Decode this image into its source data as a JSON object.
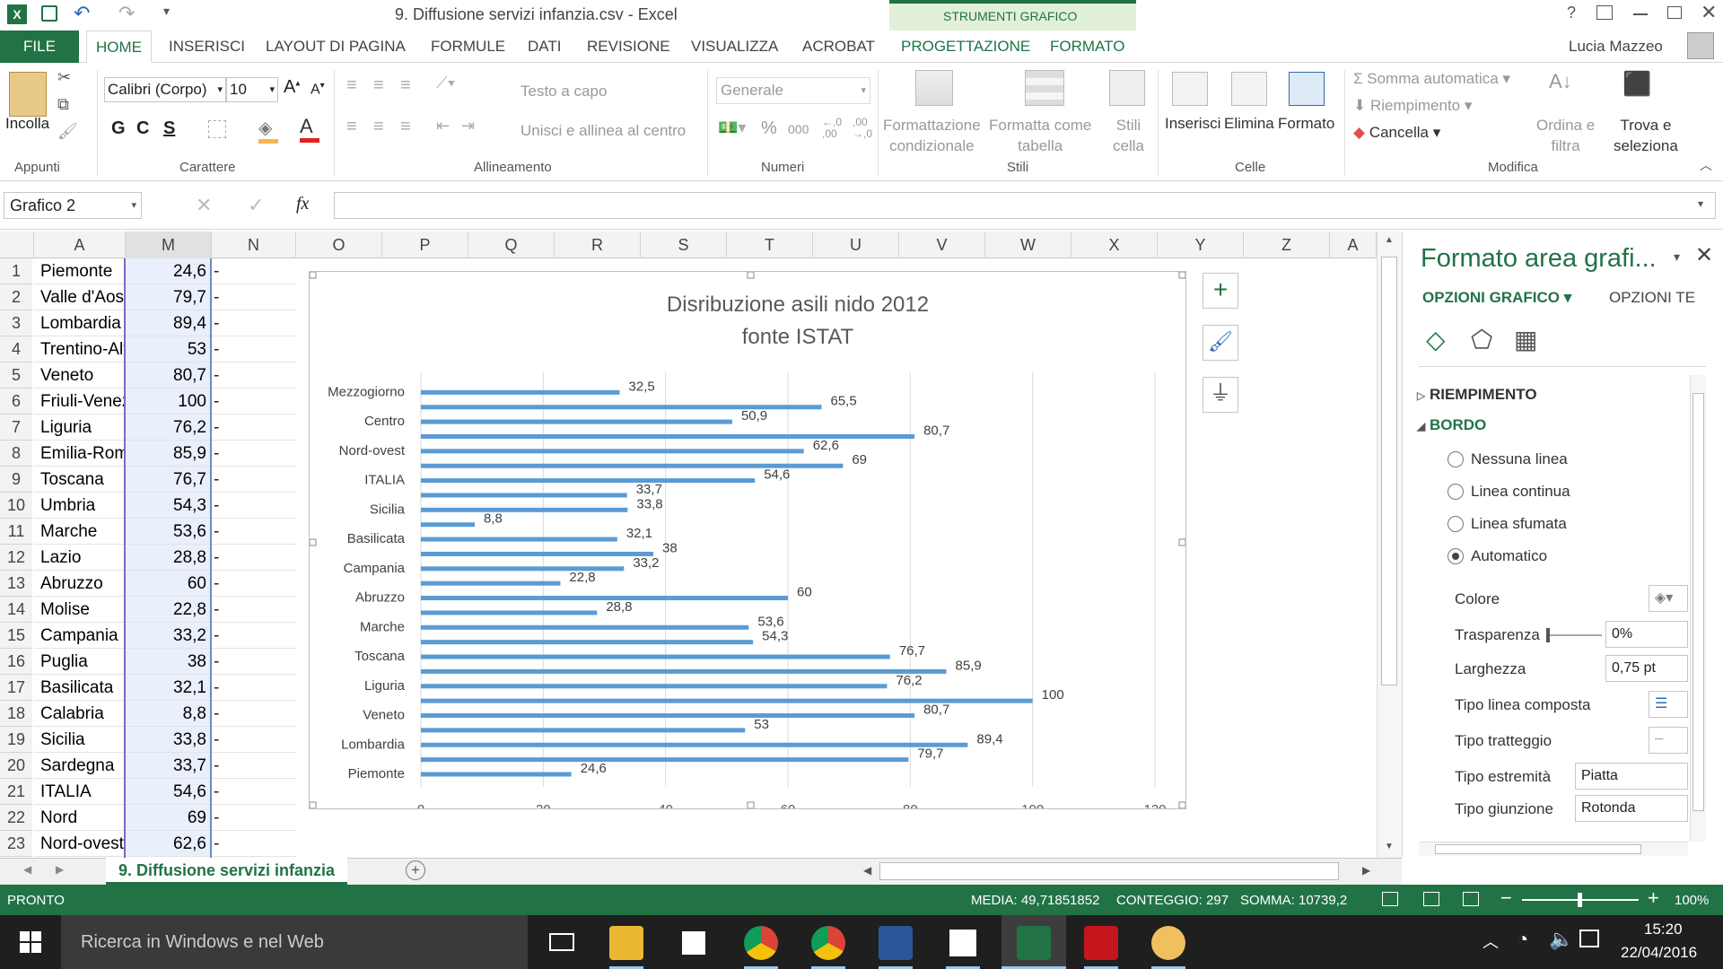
{
  "window": {
    "title": "9. Diffusione servizi infanzia.csv - Excel",
    "tools_group": "STRUMENTI GRAFICO",
    "user": "Lucia Mazzeo"
  },
  "tabs": [
    "FILE",
    "HOME",
    "INSERISCI",
    "LAYOUT DI PAGINA",
    "FORMULE",
    "DATI",
    "REVISIONE",
    "VISUALIZZA",
    "ACROBAT",
    "PROGETTAZIONE",
    "FORMATO"
  ],
  "ribbon": {
    "incolla": "Incolla",
    "font_name": "Calibri (Corpo)",
    "font_size": "10",
    "bold": "G",
    "italic": "C",
    "underline": "S",
    "testo_a_capo": "Testo a capo",
    "unisci": "Unisci e allinea al centro",
    "number_format": "Generale",
    "percent": "%",
    "thousands": "000",
    "dec_inc": "←,0\n,00",
    "dec_dec": ",00\n→,0",
    "formattazione": "Formattazione\ncondizionale",
    "formatta_tabella": "Formatta come\ntabella",
    "stili_cella": "Stili\ncella",
    "inserisci": "Inserisci",
    "elimina": "Elimina",
    "formato": "Formato",
    "somma": "Somma automatica",
    "riempimento": "Riempimento",
    "cancella": "Cancella",
    "ordina": "Ordina e\nfiltra",
    "trova": "Trova e\nseleziona",
    "groups": [
      "Appunti",
      "Carattere",
      "Allineamento",
      "Numeri",
      "Stili",
      "Celle",
      "Modifica"
    ]
  },
  "formula_bar": {
    "name_box": "Grafico 2",
    "fx": "fx",
    "value": ""
  },
  "columns": [
    "A",
    "M",
    "N",
    "O",
    "P",
    "Q",
    "R",
    "S",
    "T",
    "U",
    "V",
    "W",
    "X",
    "Y",
    "Z",
    "A"
  ],
  "rows": [
    {
      "n": "1",
      "a": "Piemonte",
      "m": "24,6",
      "n_col": "-"
    },
    {
      "n": "2",
      "a": "Valle d'Aosta",
      "m": "79,7",
      "n_col": "-"
    },
    {
      "n": "3",
      "a": "Lombardia",
      "m": "89,4",
      "n_col": "-"
    },
    {
      "n": "4",
      "a": "Trentino-Alto Adige",
      "m": "53",
      "n_col": "-"
    },
    {
      "n": "5",
      "a": "Veneto",
      "m": "80,7",
      "n_col": "-"
    },
    {
      "n": "6",
      "a": "Friuli-Venezia Giulia",
      "m": "100",
      "n_col": "-"
    },
    {
      "n": "7",
      "a": "Liguria",
      "m": "76,2",
      "n_col": "-"
    },
    {
      "n": "8",
      "a": "Emilia-Romagna",
      "m": "85,9",
      "n_col": "-"
    },
    {
      "n": "9",
      "a": "Toscana",
      "m": "76,7",
      "n_col": "-"
    },
    {
      "n": "10",
      "a": "Umbria",
      "m": "54,3",
      "n_col": "-"
    },
    {
      "n": "11",
      "a": "Marche",
      "m": "53,6",
      "n_col": "-"
    },
    {
      "n": "12",
      "a": "Lazio",
      "m": "28,8",
      "n_col": "-"
    },
    {
      "n": "13",
      "a": "Abruzzo",
      "m": "60",
      "n_col": "-"
    },
    {
      "n": "14",
      "a": "Molise",
      "m": "22,8",
      "n_col": "-"
    },
    {
      "n": "15",
      "a": "Campania",
      "m": "33,2",
      "n_col": "-"
    },
    {
      "n": "16",
      "a": "Puglia",
      "m": "38",
      "n_col": "-"
    },
    {
      "n": "17",
      "a": "Basilicata",
      "m": "32,1",
      "n_col": "-"
    },
    {
      "n": "18",
      "a": "Calabria",
      "m": "8,8",
      "n_col": "-"
    },
    {
      "n": "19",
      "a": "Sicilia",
      "m": "33,8",
      "n_col": "-"
    },
    {
      "n": "20",
      "a": "Sardegna",
      "m": "33,7",
      "n_col": "-"
    },
    {
      "n": "21",
      "a": "ITALIA",
      "m": "54,6",
      "n_col": "-"
    },
    {
      "n": "22",
      "a": "Nord",
      "m": "69",
      "n_col": "-"
    },
    {
      "n": "23",
      "a": "Nord-ovest",
      "m": "62,6",
      "n_col": "-"
    }
  ],
  "chart_data": {
    "type": "bar",
    "orientation": "horizontal",
    "title": "Disribuzione asili nido 2012",
    "subtitle": "fonte ISTAT",
    "xlim": [
      0,
      120
    ],
    "xticks": [
      "0",
      "20",
      "40",
      "60",
      "80",
      "100",
      "120"
    ],
    "category_labels": [
      "Piemonte",
      "Lombardia",
      "Veneto",
      "Liguria",
      "Toscana",
      "Marche",
      "Abruzzo",
      "Campania",
      "Basilicata",
      "Sicilia",
      "ITALIA",
      "Nord-ovest",
      "Centro",
      "Mezzogiorno"
    ],
    "values": [
      24.6,
      79.7,
      89.4,
      53,
      80.7,
      100,
      76.2,
      85.9,
      76.7,
      54.3,
      53.6,
      28.8,
      60,
      22.8,
      33.2,
      38,
      32.1,
      8.8,
      33.8,
      33.7,
      54.6,
      69,
      62.6,
      80.7,
      50.9,
      65.5,
      32.5
    ],
    "value_labels": [
      "24,6",
      "79,7",
      "89,4",
      "53",
      "80,7",
      "100",
      "76,2",
      "85,9",
      "76,7",
      "54,3",
      "53,6",
      "28,8",
      "60",
      "22,8",
      "33,2",
      "38",
      "32,1",
      "8,8",
      "33,8",
      "33,7",
      "54,6",
      "69",
      "62,6",
      "80,7",
      "50,9",
      "65,5",
      "32,5"
    ],
    "bar_color": "#5b9bd5",
    "grid": true
  },
  "pane": {
    "title": "Formato area grafi...",
    "tab1": "OPZIONI GRAFICO",
    "tab2": "OPZIONI TE",
    "riempimento": "RIEMPIMENTO",
    "bordo": "BORDO",
    "radios": [
      "Nessuna linea",
      "Linea continua",
      "Linea sfumata",
      "Automatico"
    ],
    "colore": "Colore",
    "trasparenza": "Trasparenza",
    "trasparenza_val": "0%",
    "larghezza": "Larghezza",
    "larghezza_val": "0,75 pt",
    "tipo_composta": "Tipo linea composta",
    "tipo_tratteggio": "Tipo tratteggio",
    "tipo_estremita": "Tipo estremità",
    "estremita_val": "Piatta",
    "tipo_giunzione": "Tipo giunzione",
    "giunzione_val": "Rotonda"
  },
  "sheet_tab": "9. Diffusione servizi infanzia",
  "status": {
    "ready": "PRONTO",
    "media": "MEDIA: 49,71851852",
    "conteggio": "CONTEGGIO: 297",
    "somma": "SOMMA: 10739,2",
    "zoom": "100%"
  },
  "taskbar": {
    "search": "Ricerca in Windows e nel Web",
    "time": "15:20",
    "date": "22/04/2016"
  },
  "colors": {
    "excel_green": "#217346",
    "accent_blue": "#5b9bd5"
  }
}
